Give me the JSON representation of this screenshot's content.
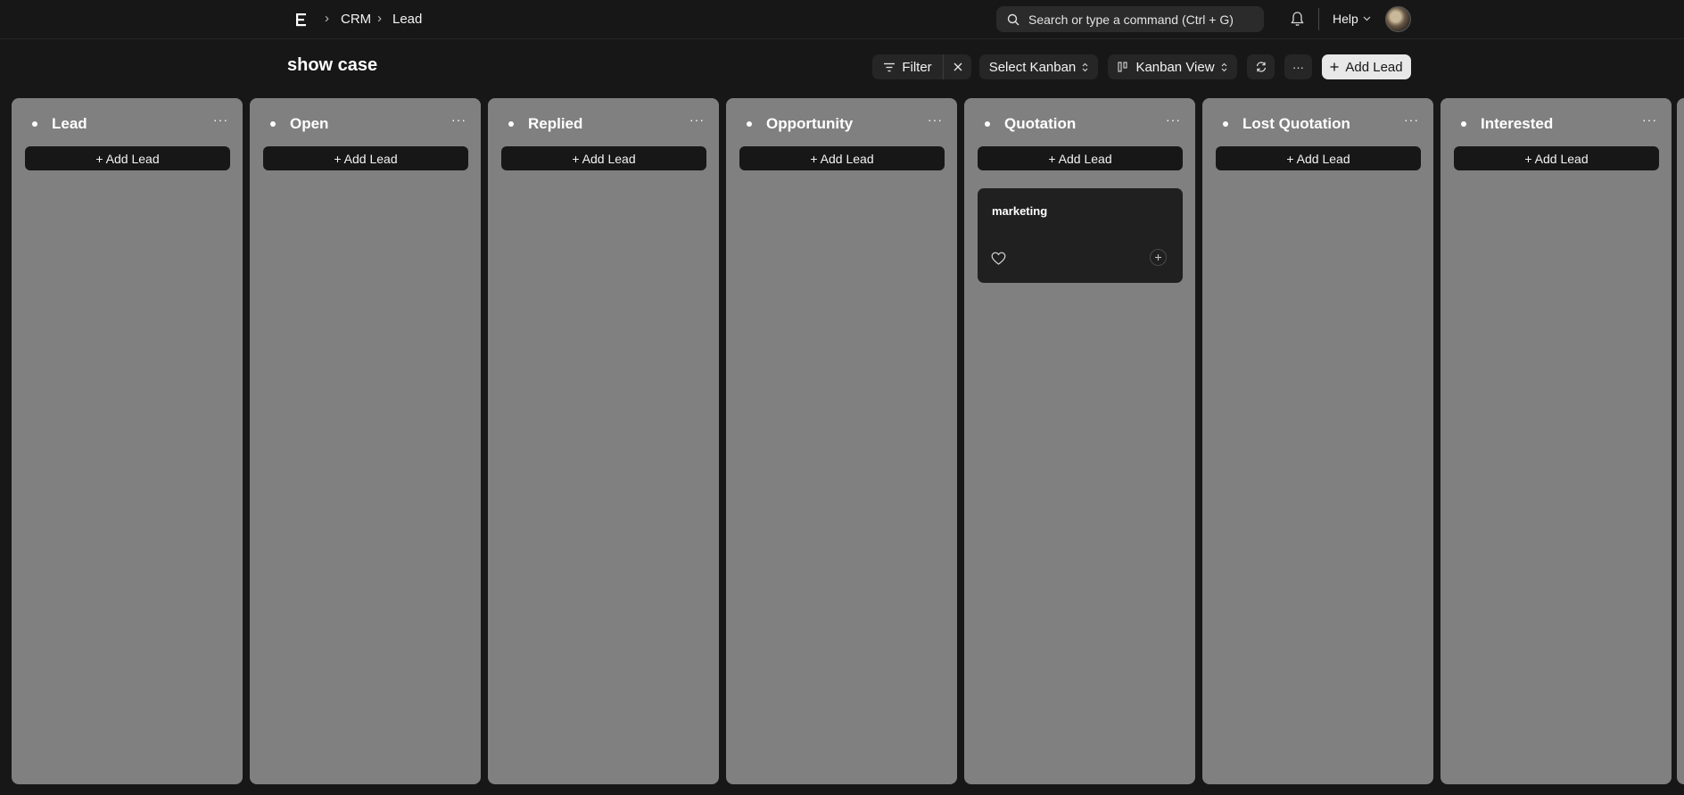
{
  "navbar": {
    "breadcrumbs": [
      "CRM",
      "Lead"
    ],
    "search_placeholder": "Search or type a command (Ctrl + G)",
    "help_label": "Help"
  },
  "page": {
    "title": "show case"
  },
  "toolbar": {
    "filter_label": "Filter",
    "select_kanban_label": "Select Kanban",
    "view_label": "Kanban View",
    "more_label": "···",
    "add_lead_label": "Add Lead"
  },
  "board": {
    "column_menu_label": "···",
    "add_label": "+ Add Lead",
    "columns": [
      {
        "title": "Lead"
      },
      {
        "title": "Open"
      },
      {
        "title": "Replied"
      },
      {
        "title": "Opportunity"
      },
      {
        "title": "Quotation",
        "cards": [
          {
            "title": "marketing"
          }
        ]
      },
      {
        "title": "Lost Quotation"
      },
      {
        "title": "Interested"
      }
    ]
  },
  "colors": {
    "background": "#171717",
    "column": "#808080",
    "card": "#202020",
    "primary_button": "#e8e8e8"
  }
}
